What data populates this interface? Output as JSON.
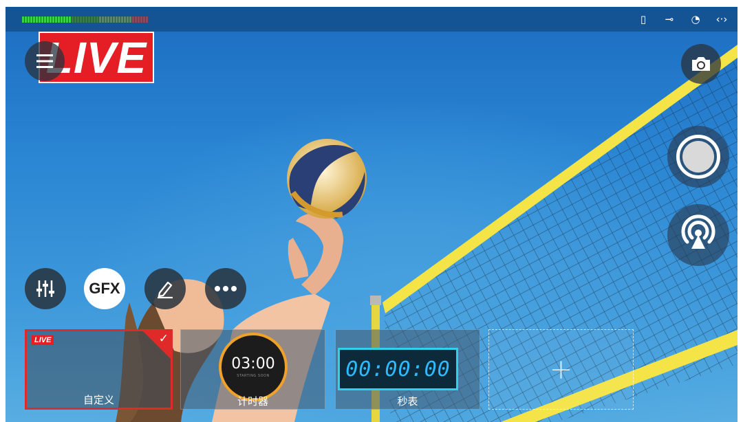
{
  "app": {
    "live_logo_text": "LIVE",
    "gfx_label": "GFX"
  },
  "status_icons": [
    "sd-card-icon",
    "usb-icon",
    "wifi-icon",
    "ethernet-icon"
  ],
  "status_glyphs": [
    "▯",
    "⊸",
    "◔",
    "‹·›"
  ],
  "overlay_cards": [
    {
      "label": "自定义",
      "badge": "LIVE",
      "selected": true
    },
    {
      "label": "计时器",
      "time": "03:00",
      "subtext": "STARTING SOON"
    },
    {
      "label": "秒表",
      "time": "00:00:00"
    },
    {
      "label": "",
      "add": "+"
    }
  ],
  "colors": {
    "live_red": "#e51e25",
    "accent_orange": "#f0a12a",
    "stopwatch_cyan": "#2fd3e8"
  }
}
